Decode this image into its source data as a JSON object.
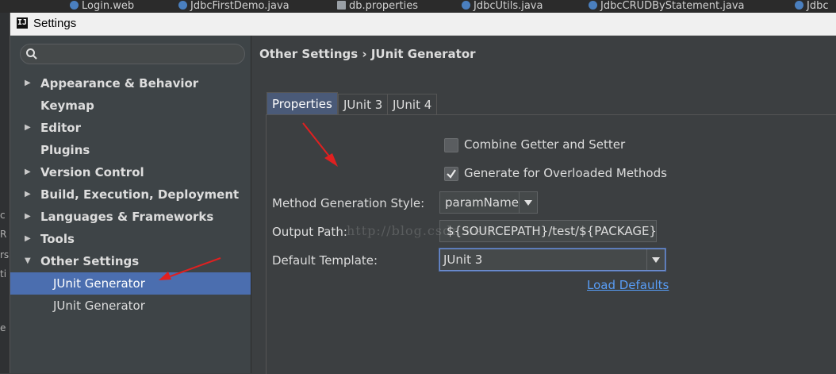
{
  "editor_tabs": [
    "Login.web",
    "JdbcFirstDemo.java",
    "db.properties",
    "JdbcUtils.java",
    "JdbcCRUDByStatement.java",
    "Jdbc"
  ],
  "ide_left_chars": [
    "c",
    "R",
    "rs",
    "ti",
    "e"
  ],
  "window": {
    "title": "Settings",
    "app_icon": "IJ"
  },
  "search": {
    "placeholder": "",
    "icon": "search-icon"
  },
  "sidebar": {
    "items": [
      {
        "label": "Appearance & Behavior",
        "expandable": true,
        "expanded": false
      },
      {
        "label": "Keymap",
        "expandable": false
      },
      {
        "label": "Editor",
        "expandable": true,
        "expanded": false
      },
      {
        "label": "Plugins",
        "expandable": false
      },
      {
        "label": "Version Control",
        "expandable": true,
        "expanded": false
      },
      {
        "label": "Build, Execution, Deployment",
        "expandable": true,
        "expanded": false
      },
      {
        "label": "Languages & Frameworks",
        "expandable": true,
        "expanded": false
      },
      {
        "label": "Tools",
        "expandable": true,
        "expanded": false
      },
      {
        "label": "Other Settings",
        "expandable": true,
        "expanded": true
      }
    ],
    "sub_items": [
      {
        "label": "JUnit Generator",
        "selected": true
      },
      {
        "label": "JUnit Generator",
        "selected": false
      }
    ]
  },
  "breadcrumb": "Other Settings › JUnit Generator",
  "tabs": [
    {
      "label": "Properties",
      "active": true
    },
    {
      "label": "JUnit 3",
      "active": false
    },
    {
      "label": "JUnit 4",
      "active": false
    }
  ],
  "options": {
    "combine_getter_setter": {
      "label": "Combine Getter and Setter",
      "checked": false
    },
    "generate_overloaded": {
      "label": "Generate for Overloaded Methods",
      "checked": true
    }
  },
  "form": {
    "method_style": {
      "label": "Method Generation Style:",
      "value": "paramName"
    },
    "output_path": {
      "label": "Output Path:",
      "value": "${SOURCEPATH}/test/${PACKAGE}/${FILENAME}"
    },
    "default_template": {
      "label": "Default Template:",
      "value": "JUnit 3"
    }
  },
  "load_defaults": "Load Defaults",
  "watermark": "http://blog.csdn.net/",
  "colors": {
    "accent": "#4b6eaf",
    "annotation_arrow": "#e02020",
    "link": "#589df6"
  }
}
